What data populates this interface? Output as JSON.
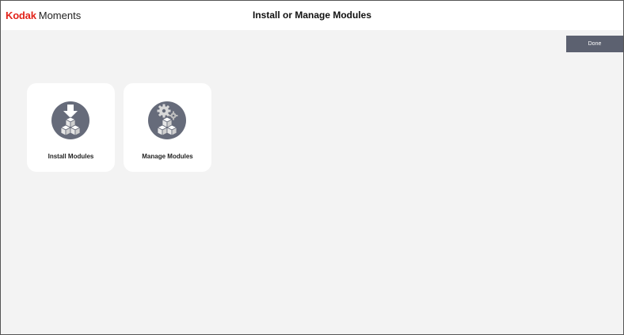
{
  "app": {
    "brand": "Kodak",
    "product": "Moments"
  },
  "header": {
    "title": "Install or Manage Modules"
  },
  "toolbar": {
    "done_label": "Done"
  },
  "tiles": [
    {
      "label": "Install Modules",
      "icon": "install-modules-icon"
    },
    {
      "label": "Manage Modules",
      "icon": "manage-modules-icon"
    }
  ],
  "colors": {
    "brand_red": "#e2231a",
    "button_bg": "#5c6170",
    "icon_circle": "#666b7a",
    "background": "#f3f3f3"
  }
}
